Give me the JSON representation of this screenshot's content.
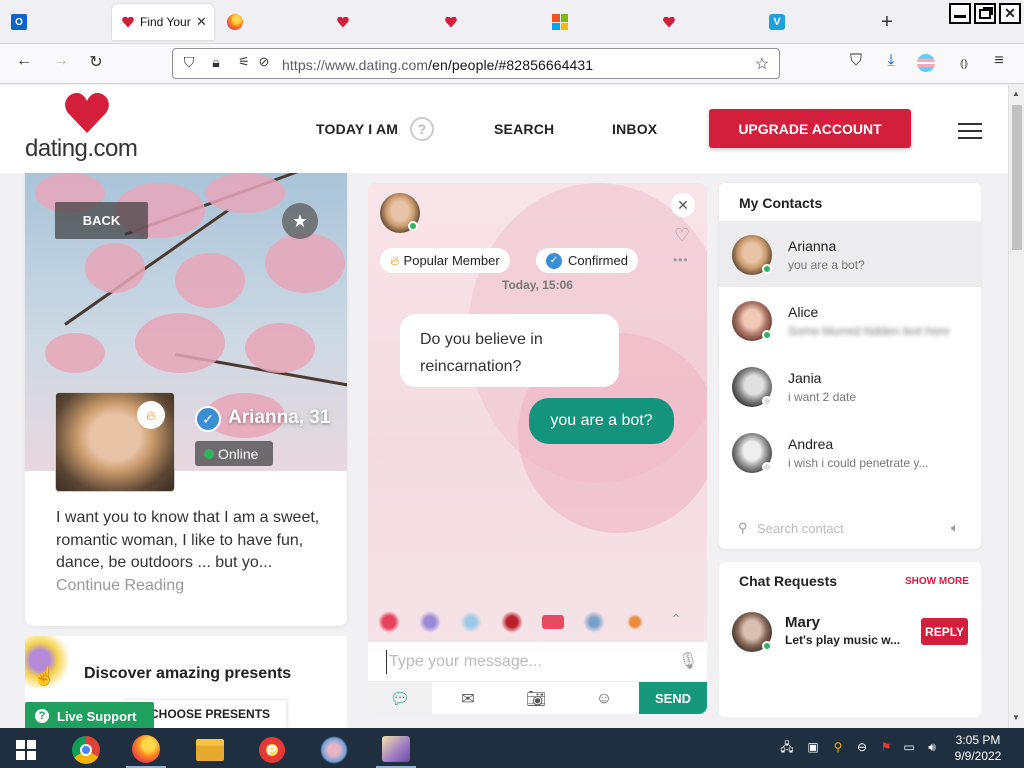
{
  "browser": {
    "active_tab_title": "Find Your",
    "tab_close": "✕",
    "new_tab": "+",
    "url_host": "https://www.dating.com",
    "url_path": "/en/people/#82856664431",
    "outlook_letter": "O",
    "vimeo_letter": "V"
  },
  "header": {
    "logo_text": "dating.com",
    "menu": {
      "today": "TODAY I AM",
      "search": "SEARCH",
      "inbox": "INBOX"
    },
    "help_glyph": "?",
    "upgrade": "UPGRADE ACCOUNT"
  },
  "profile": {
    "back": "BACK",
    "name_age": "Arianna, 31",
    "status": "Online",
    "bio": "I want you to know that I am a sweet, romantic woman, I like to have fun, dance, be outdoors ... but yo...",
    "continue": "Continue Reading"
  },
  "presents": {
    "title": "Discover amazing presents",
    "choose": "CHOOSE PRESENTS"
  },
  "live_support": "Live Support",
  "chat": {
    "badges": {
      "popular": "Popular Member",
      "confirmed": "Confirmed"
    },
    "timestamp": "Today, 15:06",
    "incoming": "Do you believe in reincarnation?",
    "outgoing": "you are a bot?",
    "input_placeholder": "Type your message...",
    "send": "SEND",
    "more": "•••"
  },
  "contacts": {
    "title": "My Contacts",
    "items": [
      {
        "name": "Arianna",
        "message": "you are a bot?",
        "online": true
      },
      {
        "name": "Alice",
        "message": "Some blurred hidden text here",
        "online": true
      },
      {
        "name": "Jania",
        "message": "i want 2 date",
        "online": false
      },
      {
        "name": "Andrea",
        "message": "i wish i could penetrate y...",
        "online": false
      }
    ],
    "search_placeholder": "Search contact"
  },
  "requests": {
    "title": "Chat Requests",
    "show_more": "SHOW MORE",
    "item": {
      "name": "Mary",
      "message": "Let's play music w..."
    },
    "reply": "REPLY"
  },
  "taskbar": {
    "time": "3:05 PM",
    "date": "9/9/2022"
  },
  "colors": {
    "brand_red": "#d41f3c",
    "send_green": "#16987a",
    "bubble_out": "#14937d",
    "online_green": "#2db55d",
    "live_support": "#20a05f"
  }
}
